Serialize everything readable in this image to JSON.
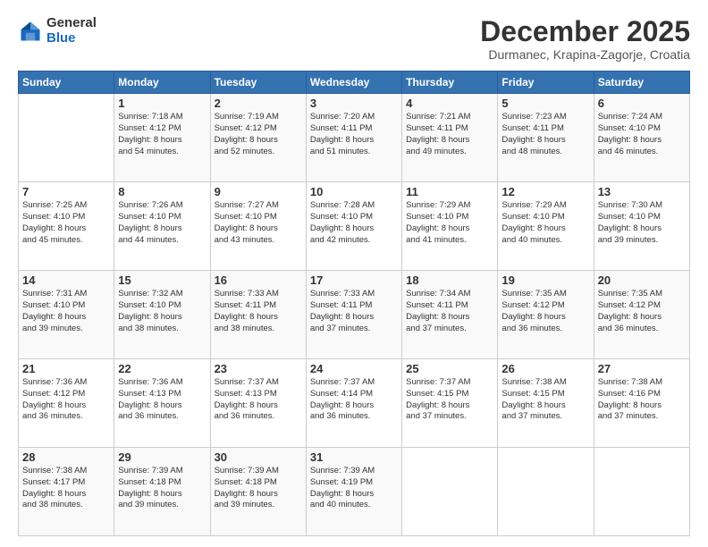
{
  "header": {
    "logo_general": "General",
    "logo_blue": "Blue",
    "month_title": "December 2025",
    "location": "Durmanec, Krapina-Zagorje, Croatia"
  },
  "calendar": {
    "days_of_week": [
      "Sunday",
      "Monday",
      "Tuesday",
      "Wednesday",
      "Thursday",
      "Friday",
      "Saturday"
    ],
    "weeks": [
      [
        {
          "day": "",
          "info": ""
        },
        {
          "day": "1",
          "info": "Sunrise: 7:18 AM\nSunset: 4:12 PM\nDaylight: 8 hours\nand 54 minutes."
        },
        {
          "day": "2",
          "info": "Sunrise: 7:19 AM\nSunset: 4:12 PM\nDaylight: 8 hours\nand 52 minutes."
        },
        {
          "day": "3",
          "info": "Sunrise: 7:20 AM\nSunset: 4:11 PM\nDaylight: 8 hours\nand 51 minutes."
        },
        {
          "day": "4",
          "info": "Sunrise: 7:21 AM\nSunset: 4:11 PM\nDaylight: 8 hours\nand 49 minutes."
        },
        {
          "day": "5",
          "info": "Sunrise: 7:23 AM\nSunset: 4:11 PM\nDaylight: 8 hours\nand 48 minutes."
        },
        {
          "day": "6",
          "info": "Sunrise: 7:24 AM\nSunset: 4:10 PM\nDaylight: 8 hours\nand 46 minutes."
        }
      ],
      [
        {
          "day": "7",
          "info": "Sunrise: 7:25 AM\nSunset: 4:10 PM\nDaylight: 8 hours\nand 45 minutes."
        },
        {
          "day": "8",
          "info": "Sunrise: 7:26 AM\nSunset: 4:10 PM\nDaylight: 8 hours\nand 44 minutes."
        },
        {
          "day": "9",
          "info": "Sunrise: 7:27 AM\nSunset: 4:10 PM\nDaylight: 8 hours\nand 43 minutes."
        },
        {
          "day": "10",
          "info": "Sunrise: 7:28 AM\nSunset: 4:10 PM\nDaylight: 8 hours\nand 42 minutes."
        },
        {
          "day": "11",
          "info": "Sunrise: 7:29 AM\nSunset: 4:10 PM\nDaylight: 8 hours\nand 41 minutes."
        },
        {
          "day": "12",
          "info": "Sunrise: 7:29 AM\nSunset: 4:10 PM\nDaylight: 8 hours\nand 40 minutes."
        },
        {
          "day": "13",
          "info": "Sunrise: 7:30 AM\nSunset: 4:10 PM\nDaylight: 8 hours\nand 39 minutes."
        }
      ],
      [
        {
          "day": "14",
          "info": "Sunrise: 7:31 AM\nSunset: 4:10 PM\nDaylight: 8 hours\nand 39 minutes."
        },
        {
          "day": "15",
          "info": "Sunrise: 7:32 AM\nSunset: 4:10 PM\nDaylight: 8 hours\nand 38 minutes."
        },
        {
          "day": "16",
          "info": "Sunrise: 7:33 AM\nSunset: 4:11 PM\nDaylight: 8 hours\nand 38 minutes."
        },
        {
          "day": "17",
          "info": "Sunrise: 7:33 AM\nSunset: 4:11 PM\nDaylight: 8 hours\nand 37 minutes."
        },
        {
          "day": "18",
          "info": "Sunrise: 7:34 AM\nSunset: 4:11 PM\nDaylight: 8 hours\nand 37 minutes."
        },
        {
          "day": "19",
          "info": "Sunrise: 7:35 AM\nSunset: 4:12 PM\nDaylight: 8 hours\nand 36 minutes."
        },
        {
          "day": "20",
          "info": "Sunrise: 7:35 AM\nSunset: 4:12 PM\nDaylight: 8 hours\nand 36 minutes."
        }
      ],
      [
        {
          "day": "21",
          "info": "Sunrise: 7:36 AM\nSunset: 4:12 PM\nDaylight: 8 hours\nand 36 minutes."
        },
        {
          "day": "22",
          "info": "Sunrise: 7:36 AM\nSunset: 4:13 PM\nDaylight: 8 hours\nand 36 minutes."
        },
        {
          "day": "23",
          "info": "Sunrise: 7:37 AM\nSunset: 4:13 PM\nDaylight: 8 hours\nand 36 minutes."
        },
        {
          "day": "24",
          "info": "Sunrise: 7:37 AM\nSunset: 4:14 PM\nDaylight: 8 hours\nand 36 minutes."
        },
        {
          "day": "25",
          "info": "Sunrise: 7:37 AM\nSunset: 4:15 PM\nDaylight: 8 hours\nand 37 minutes."
        },
        {
          "day": "26",
          "info": "Sunrise: 7:38 AM\nSunset: 4:15 PM\nDaylight: 8 hours\nand 37 minutes."
        },
        {
          "day": "27",
          "info": "Sunrise: 7:38 AM\nSunset: 4:16 PM\nDaylight: 8 hours\nand 37 minutes."
        }
      ],
      [
        {
          "day": "28",
          "info": "Sunrise: 7:38 AM\nSunset: 4:17 PM\nDaylight: 8 hours\nand 38 minutes."
        },
        {
          "day": "29",
          "info": "Sunrise: 7:39 AM\nSunset: 4:18 PM\nDaylight: 8 hours\nand 39 minutes."
        },
        {
          "day": "30",
          "info": "Sunrise: 7:39 AM\nSunset: 4:18 PM\nDaylight: 8 hours\nand 39 minutes."
        },
        {
          "day": "31",
          "info": "Sunrise: 7:39 AM\nSunset: 4:19 PM\nDaylight: 8 hours\nand 40 minutes."
        },
        {
          "day": "",
          "info": ""
        },
        {
          "day": "",
          "info": ""
        },
        {
          "day": "",
          "info": ""
        }
      ]
    ]
  }
}
